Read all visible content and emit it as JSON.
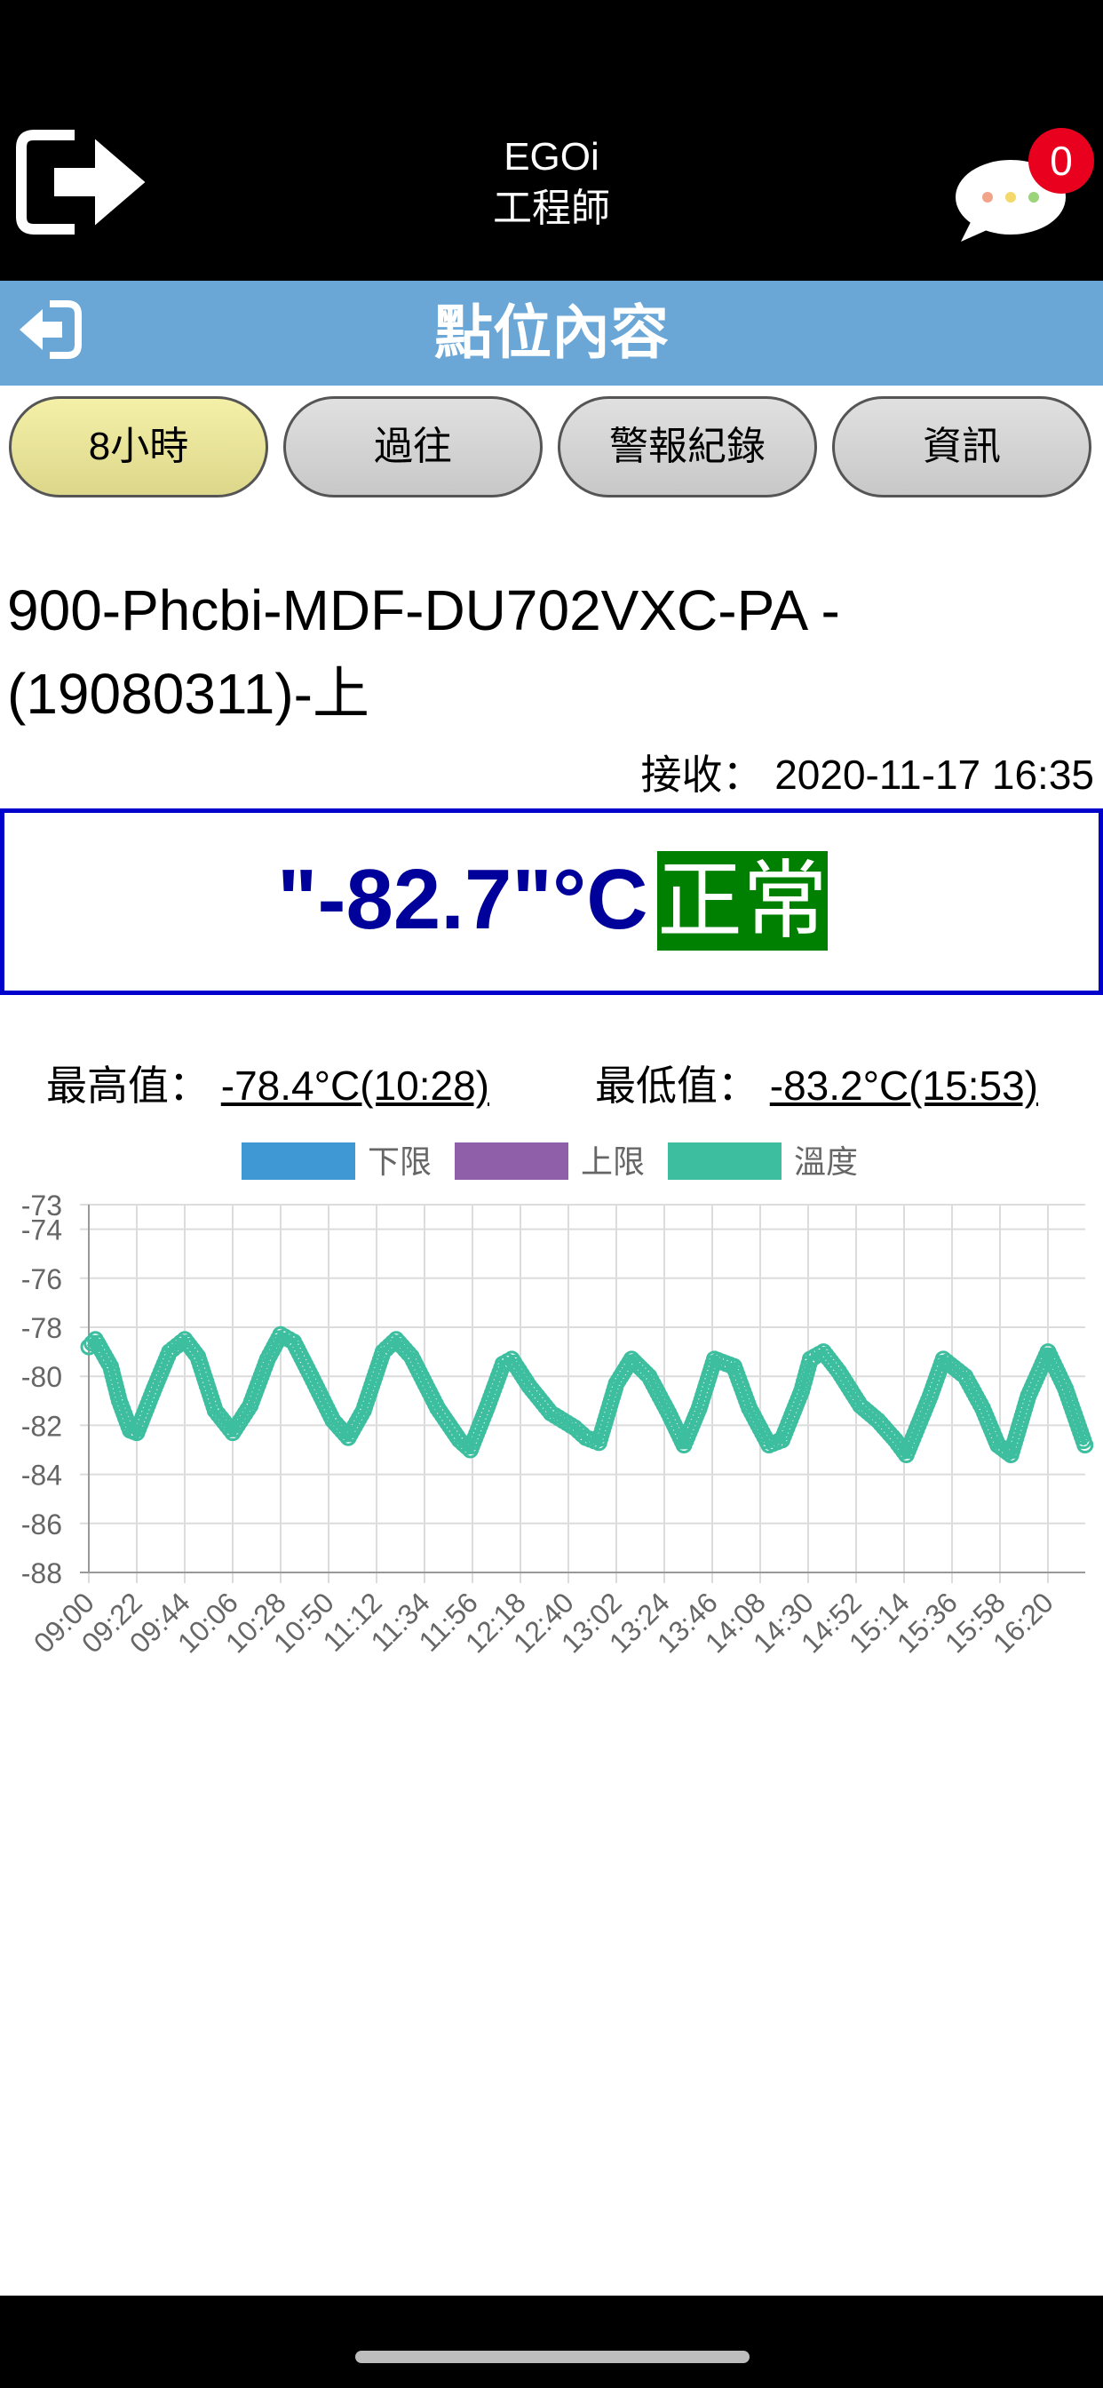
{
  "header": {
    "app_name": "EGOi",
    "app_role": "工程師",
    "message_count": "0",
    "icons": {
      "logout": "logout-arrow-icon",
      "messages": "chat-bubble-icon"
    }
  },
  "sub_header": {
    "title": "點位內容",
    "back_icon": "back-arrow-icon"
  },
  "tabs": [
    {
      "label": "8小時",
      "active": true
    },
    {
      "label": "過往",
      "active": false
    },
    {
      "label": "警報紀錄",
      "active": false
    },
    {
      "label": "資訊",
      "active": false
    }
  ],
  "device": {
    "name": "900-Phcbi-MDF-DU702VXC-PA -(19080311)-上",
    "received_label": "接收：",
    "received_time": "2020-11-17 16:35"
  },
  "reading": {
    "value": "\"-82.7\"°C",
    "status": "正常",
    "status_color": "#008000",
    "value_color": "#00009a"
  },
  "stats": {
    "max_label": "最高值：",
    "max_value": "-78.4°C(10:28)",
    "min_label": "最低值：",
    "min_value": "-83.2°C(15:53)"
  },
  "chart_data": {
    "type": "line",
    "legend": [
      {
        "name": "下限",
        "color": "#3f97d3"
      },
      {
        "name": "上限",
        "color": "#8f5fa9"
      },
      {
        "name": "溫度",
        "color": "#3dbf9f"
      }
    ],
    "legend_position": "top",
    "grid": true,
    "ylim": [
      -88,
      -73
    ],
    "y_ticks": [
      "-73",
      "-74",
      "-76",
      "-78",
      "-80",
      "-82",
      "-84",
      "-86",
      "-88"
    ],
    "x_ticks": [
      "09:00",
      "09:22",
      "09:44",
      "10:06",
      "10:28",
      "10:50",
      "11:12",
      "11:34",
      "11:56",
      "12:18",
      "12:40",
      "13:02",
      "13:24",
      "13:46",
      "14:08",
      "14:30",
      "14:52",
      "15:14",
      "15:36",
      "15:58",
      "16:20"
    ],
    "series": [
      {
        "name": "溫度",
        "x": [
          "09:00",
          "09:03",
          "09:10",
          "09:14",
          "09:19",
          "09:22",
          "09:30",
          "09:37",
          "09:44",
          "09:50",
          "09:58",
          "10:06",
          "10:14",
          "10:22",
          "10:28",
          "10:34",
          "10:42",
          "10:52",
          "10:59",
          "11:06",
          "11:15",
          "11:21",
          "11:28",
          "11:40",
          "11:50",
          "11:55",
          "12:03",
          "12:10",
          "12:14",
          "12:22",
          "12:32",
          "12:43",
          "12:48",
          "12:54",
          "13:02",
          "13:09",
          "13:17",
          "13:26",
          "13:33",
          "13:40",
          "13:47",
          "13:56",
          "14:03",
          "14:12",
          "14:18",
          "14:27",
          "14:31",
          "14:37",
          "14:44",
          "14:54",
          "15:02",
          "15:10",
          "15:15",
          "15:26",
          "15:32",
          "15:42",
          "15:50",
          "15:57",
          "16:03",
          "16:11",
          "16:20",
          "16:28",
          "16:37"
        ],
        "values": [
          -78.8,
          -78.5,
          -79.6,
          -81.0,
          -82.2,
          -82.3,
          -80.5,
          -79.0,
          -78.5,
          -79.2,
          -81.4,
          -82.3,
          -81.2,
          -79.3,
          -78.3,
          -78.6,
          -80.0,
          -81.8,
          -82.5,
          -81.4,
          -79.0,
          -78.5,
          -79.2,
          -81.3,
          -82.6,
          -83.0,
          -81.2,
          -79.5,
          -79.3,
          -80.4,
          -81.5,
          -82.1,
          -82.5,
          -82.7,
          -80.3,
          -79.3,
          -80.0,
          -81.5,
          -82.8,
          -81.3,
          -79.3,
          -79.6,
          -81.3,
          -82.8,
          -82.6,
          -80.6,
          -79.3,
          -79.0,
          -79.8,
          -81.2,
          -81.8,
          -82.6,
          -83.2,
          -80.8,
          -79.3,
          -80.0,
          -81.3,
          -82.8,
          -83.2,
          -80.8,
          -79.0,
          -80.5,
          -82.8
        ]
      }
    ]
  }
}
